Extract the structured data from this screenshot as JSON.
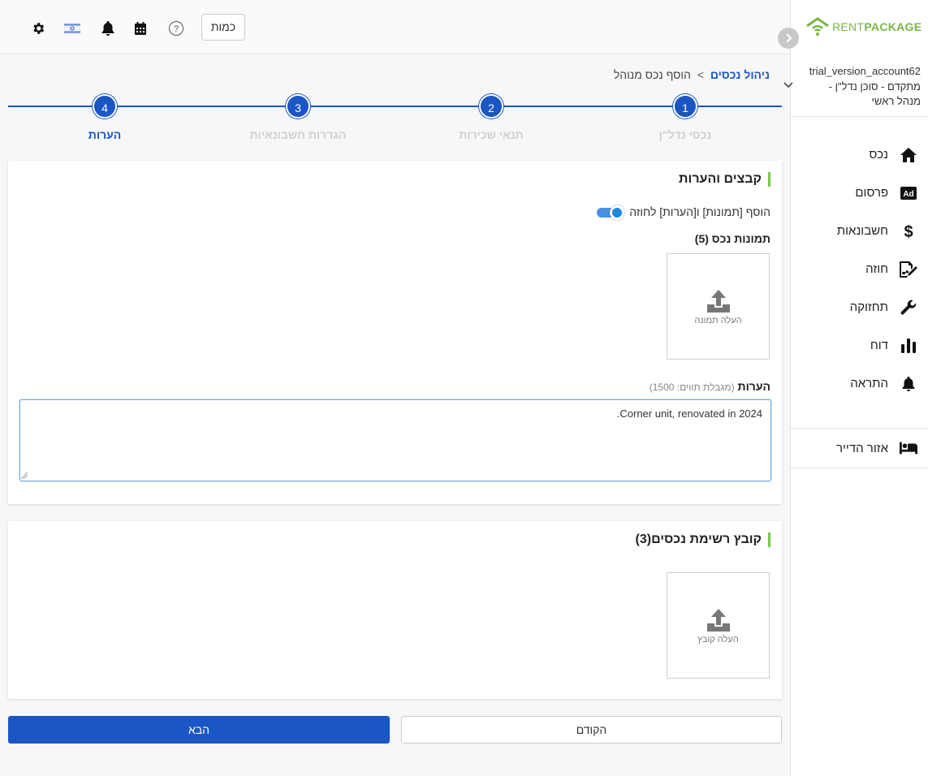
{
  "brand": {
    "logo_part1": "RENT",
    "logo_part2": "PACKAGE"
  },
  "account": {
    "name": "trial_version_account62",
    "role": "מתקדם - סוכן נדל\"ן - מנהל ראשי"
  },
  "sidebar": {
    "items": [
      {
        "label": "נכס",
        "icon": "home-icon"
      },
      {
        "label": "פרסום",
        "icon": "ad-icon"
      },
      {
        "label": "חשבונאות",
        "icon": "dollar-icon"
      },
      {
        "label": "חוזה",
        "icon": "contract-icon"
      },
      {
        "label": "תחזוקה",
        "icon": "wrench-icon"
      },
      {
        "label": "דוח",
        "icon": "bar-chart-icon"
      },
      {
        "label": "התראה",
        "icon": "bell-icon"
      }
    ],
    "tenant_area": {
      "label": "אזור הדייר",
      "icon": "bed-icon"
    }
  },
  "topbar": {
    "kamut_label": "כמות",
    "help_symbol": "?"
  },
  "breadcrumb": {
    "link": "ניהול נכסים",
    "separator": ">",
    "current": "הוסף נכס מנוהל"
  },
  "stepper": {
    "steps": [
      {
        "number": "1",
        "label": "נכסי נדל\"ן"
      },
      {
        "number": "2",
        "label": "תנאי שכירות"
      },
      {
        "number": "3",
        "label": "הגדרות חשבונאיות"
      },
      {
        "number": "4",
        "label": "הערות"
      }
    ],
    "active_step": "4"
  },
  "files_section": {
    "title": "קבצים והערות",
    "toggle_label": "הוסף [תמונות] ו[הערות] לחוזה",
    "toggle_on": true,
    "photos_label": "תמונות נכס (5)",
    "upload_photo_text": "העלה תמונה",
    "notes_label": "הערות",
    "notes_limit": "(מגבלת תווים: 1500)",
    "notes_value": "Corner unit, renovated in 2024."
  },
  "list_section": {
    "title": "קובץ רשימת נכסים(3)",
    "upload_file_text": "העלה קובץ"
  },
  "buttons": {
    "prev": "הקודם",
    "next": "הבא"
  },
  "colors": {
    "primary": "#1a56c4",
    "accent_green": "#7ac943",
    "inactive_step": "#cfcfcf"
  }
}
